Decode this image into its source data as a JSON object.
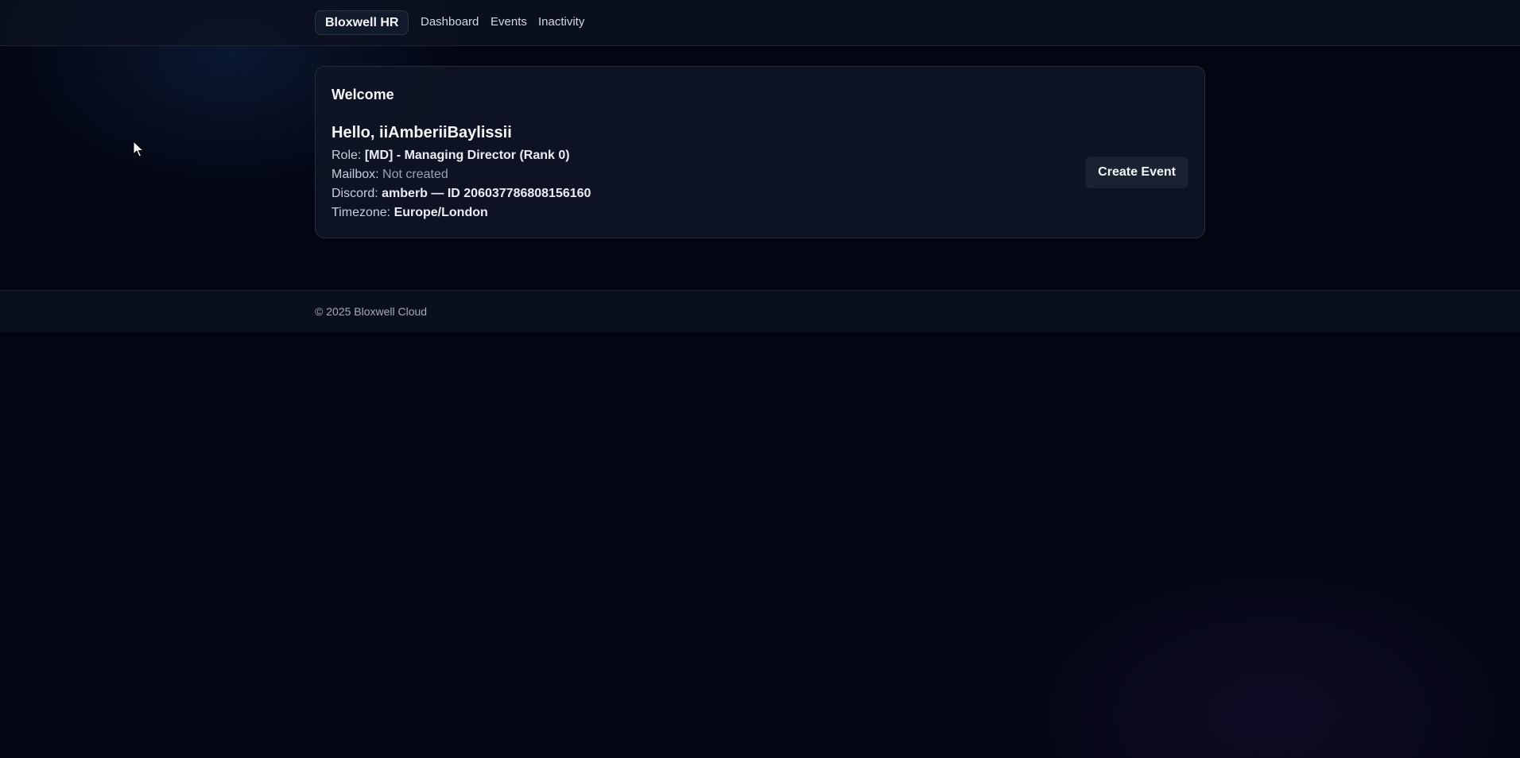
{
  "header": {
    "brand": "Bloxwell HR",
    "nav": [
      {
        "label": "Dashboard"
      },
      {
        "label": "Events"
      },
      {
        "label": "Inactivity"
      }
    ]
  },
  "welcome_card": {
    "title": "Welcome",
    "greeting": "Hello, iiAmberiiBaylissii",
    "role_label": "Role:",
    "role_value": "[MD] - Managing Director (Rank 0)",
    "mailbox_label": "Mailbox:",
    "mailbox_value": "Not created",
    "discord_label": "Discord:",
    "discord_value": "amberb — ID 206037786808156160",
    "timezone_label": "Timezone:",
    "timezone_value": "Europe/London",
    "create_event_button": "Create Event"
  },
  "footer": {
    "copyright": "© 2025 Bloxwell Cloud"
  },
  "colors": {
    "background": "#030612",
    "panel": "#0f1624",
    "border": "#232c3d",
    "text": "#f3f5f9",
    "muted_text": "#9aa3b3"
  },
  "icons": {
    "cursor": "mouse-pointer-icon"
  }
}
